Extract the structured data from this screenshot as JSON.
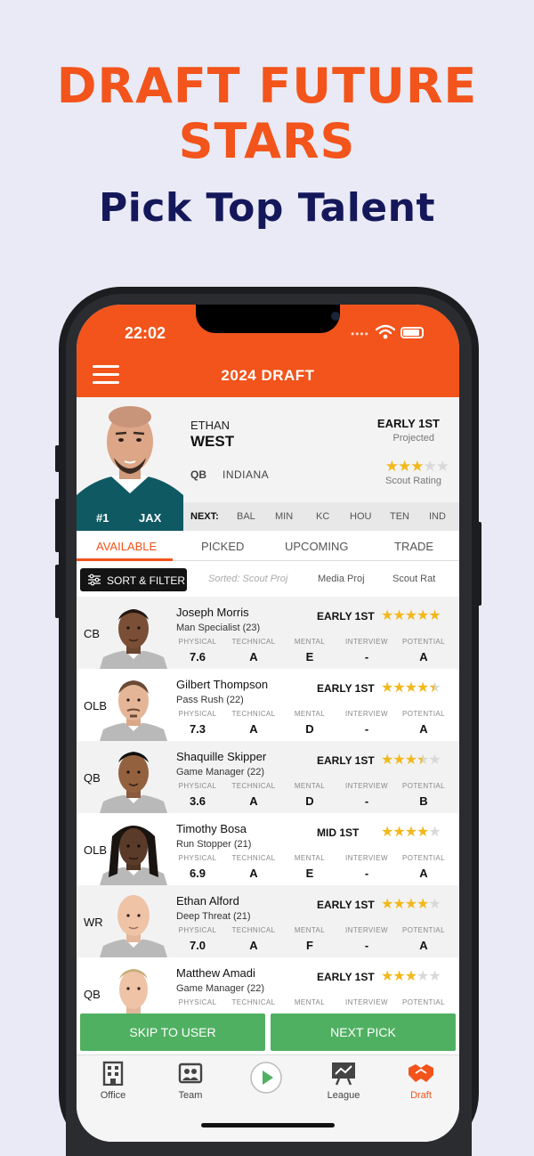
{
  "promo": {
    "headline_line1": "DRAFT FUTURE",
    "headline_line2": "STARS",
    "subhead": "Pick Top Talent"
  },
  "status_bar": {
    "time": "22:02"
  },
  "header": {
    "title": "2024 DRAFT",
    "menu_icon": "hamburger-icon"
  },
  "featured_player": {
    "first_name": "ETHAN",
    "last_name": "WEST",
    "position": "QB",
    "school": "INDIANA",
    "projected_round": "EARLY 1ST",
    "projected_label": "Projected",
    "scout_stars": 3,
    "scout_label": "Scout Rating",
    "pick_number": "#1",
    "team": "JAX"
  },
  "next_picks": {
    "label": "NEXT:",
    "teams": [
      "BAL",
      "MIN",
      "KC",
      "HOU",
      "TEN",
      "IND"
    ]
  },
  "tabs": [
    {
      "label": "AVAILABLE",
      "active": true
    },
    {
      "label": "PICKED",
      "active": false
    },
    {
      "label": "UPCOMING",
      "active": false
    },
    {
      "label": "TRADE",
      "active": false
    }
  ],
  "sort": {
    "button_label": "SORT & FILTER",
    "current": "Sorted: Scout Proj",
    "options": [
      "Media Proj",
      "Scout Rat"
    ]
  },
  "columns": [
    "PHYSICAL",
    "TECHNICAL",
    "MENTAL",
    "INTERVIEW",
    "POTENTIAL"
  ],
  "players": [
    {
      "pos": "CB",
      "name": "Joseph Morris",
      "role": "Man Specialist (23)",
      "round": "EARLY 1ST",
      "stars": 5,
      "physical": "7.6",
      "technical": "A",
      "mental": "E",
      "interview": "-",
      "potential": "A"
    },
    {
      "pos": "OLB",
      "name": "Gilbert Thompson",
      "role": "Pass Rush (22)",
      "round": "EARLY 1ST",
      "stars": 4.5,
      "physical": "7.3",
      "technical": "A",
      "mental": "D",
      "interview": "-",
      "potential": "A"
    },
    {
      "pos": "QB",
      "name": "Shaquille Skipper",
      "role": "Game Manager (22)",
      "round": "EARLY 1ST",
      "stars": 3.5,
      "physical": "3.6",
      "technical": "A",
      "mental": "D",
      "interview": "-",
      "potential": "B"
    },
    {
      "pos": "OLB",
      "name": "Timothy Bosa",
      "role": "Run Stopper (21)",
      "round": "MID 1ST",
      "stars": 4,
      "physical": "6.9",
      "technical": "A",
      "mental": "E",
      "interview": "-",
      "potential": "A"
    },
    {
      "pos": "WR",
      "name": "Ethan Alford",
      "role": "Deep Threat (21)",
      "round": "EARLY 1ST",
      "stars": 4,
      "physical": "7.0",
      "technical": "A",
      "mental": "F",
      "interview": "-",
      "potential": "A"
    },
    {
      "pos": "QB",
      "name": "Matthew Amadi",
      "role": "Game Manager (22)",
      "round": "EARLY 1ST",
      "stars": 3,
      "physical": "",
      "technical": "",
      "mental": "",
      "interview": "",
      "potential": ""
    }
  ],
  "actions": {
    "skip_label": "SKIP TO USER",
    "next_label": "NEXT PICK"
  },
  "bottom_nav": [
    {
      "label": "Office",
      "icon": "building-icon"
    },
    {
      "label": "Team",
      "icon": "team-icon"
    },
    {
      "label": "",
      "icon": "play-icon"
    },
    {
      "label": "League",
      "icon": "league-board-icon"
    },
    {
      "label": "Draft",
      "icon": "handshake-icon",
      "active": true
    }
  ],
  "colors": {
    "brand_orange": "#f2541b",
    "navy": "#14185a",
    "green": "#50b062",
    "star": "#f2b81b"
  }
}
